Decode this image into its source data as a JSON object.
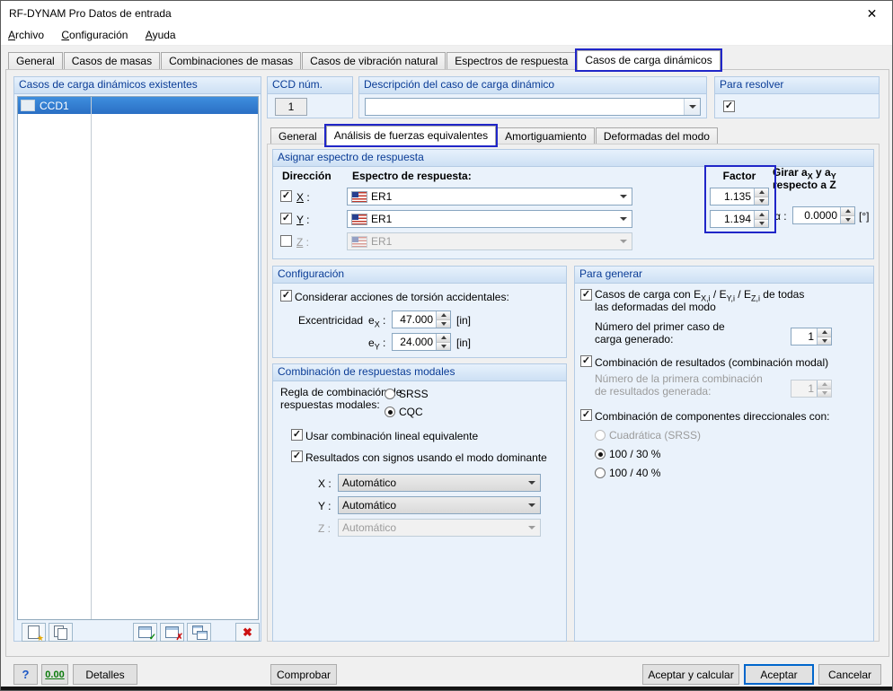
{
  "window": {
    "title": "RF-DYNAM Pro Datos de entrada",
    "close_glyph": "✕"
  },
  "colors": {
    "annotation": "#2026c8",
    "selection_blue": "#2f7fd0",
    "group_header_text": "#0a3c96",
    "default_button_border": "#0066cc"
  },
  "glyphs": {
    "check": "✓",
    "cross": "✗",
    "big_cross": "✖",
    "star": "★"
  },
  "menu": {
    "items": [
      "Archivo",
      "Configuración",
      "Ayuda"
    ]
  },
  "tabs": {
    "items": [
      "General",
      "Casos de masas",
      "Combinaciones de masas",
      "Casos de vibración natural",
      "Espectros de respuesta",
      "Casos de carga dinámicos"
    ]
  },
  "left_panel": {
    "header": "Casos de carga dinámicos existentes",
    "rows": [
      {
        "label": "CCD1"
      }
    ]
  },
  "ccd_num": {
    "header": "CCD núm.",
    "value": "1"
  },
  "description": {
    "header": "Descripción del caso de carga dinámico",
    "value": ""
  },
  "solve": {
    "header": "Para resolver"
  },
  "inner_tabs": {
    "items": [
      "General",
      "Análisis de fuerzas equivalentes",
      "Amortiguamiento",
      "Deformadas del modo"
    ]
  },
  "spectrum": {
    "header": "Asignar espectro de respuesta",
    "col_direction": "Dirección",
    "col_spectrum": "Espectro de respuesta:",
    "col_factor": "Factor",
    "rotate": {
      "p1": "Girar a",
      "s1": "X",
      "p2": " y a",
      "s2": "Y",
      "line2": "respecto a Z"
    },
    "rows": [
      {
        "label": "X :",
        "value": "ER1",
        "factor": "1.135"
      },
      {
        "label": "Y :",
        "value": "ER1",
        "factor": "1.194"
      },
      {
        "label": "Z :",
        "value": "ER1",
        "factor": ""
      }
    ],
    "alpha": {
      "label": "α :",
      "value": "0.0000",
      "unit": "[°]"
    }
  },
  "config": {
    "header": "Configuración",
    "torsion": "Considerar acciones de torsión accidentales:",
    "eccentricity": "Excentricidad",
    "ex": {
      "p": "e",
      "s": "X",
      "c": " :",
      "value": "47.000",
      "unit": "[in]"
    },
    "ey": {
      "p": "e",
      "s": "Y",
      "c": " :",
      "value": "24.000",
      "unit": "[in]"
    }
  },
  "modal": {
    "header": "Combinación de respuestas modales",
    "rule1": "Regla de combinación de",
    "rule2": "respuestas modales:",
    "srss": "SRSS",
    "cqc": "CQC",
    "linear": "Usar combinación lineal equivalente",
    "signs": "Resultados con signos usando el modo dominante",
    "x": "X :",
    "y": "Y :",
    "z": "Z :",
    "auto": "Automático"
  },
  "generate": {
    "header": "Para generar",
    "cases": {
      "p1": "Casos de carga con E",
      "s1": "X,i",
      "p2": " / E",
      "s2": "Y,i",
      "p3": " / E",
      "s3": "Z,i",
      "p4": " de todas",
      "line2": "las deformadas del modo"
    },
    "first_case1": "Número del primer caso de",
    "first_case2": "carga generado:",
    "first_case_value": "1",
    "result_combo": "Combinación de resultados (combinación modal)",
    "first_combo1": "Número de la primera combinación",
    "first_combo2": "de resultados generada:",
    "first_combo_value": "1",
    "directional": "Combinación de componentes direccionales con:",
    "quad": "Cuadrática (SRSS)",
    "c100_30": "100 / 30 %",
    "c100_40": "100 / 40 %"
  },
  "footer": {
    "help": "?",
    "units": "0.00",
    "details": "Detalles",
    "check_btn": "Comprobar",
    "accept_calc": "Aceptar y calcular",
    "accept": "Aceptar",
    "cancel": "Cancelar"
  }
}
